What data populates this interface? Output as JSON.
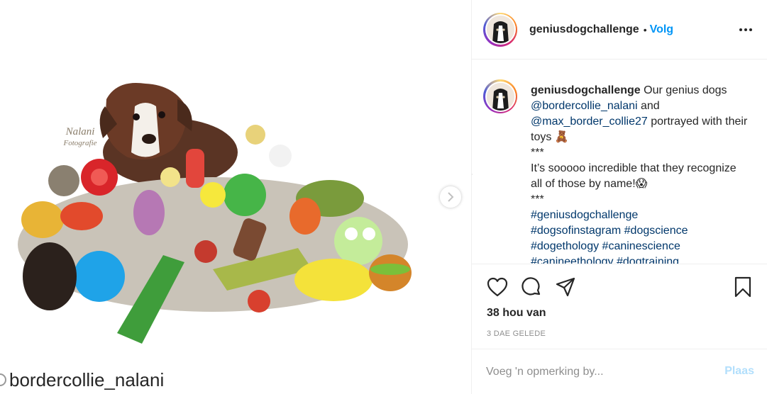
{
  "media": {
    "watermark_line1": "Nalani",
    "watermark_line2": "Fotografie",
    "tag_username": "bordercollie_nalani"
  },
  "header": {
    "username": "geniusdogchallenge",
    "separator": "•",
    "follow_label": "Volg",
    "more_icon": "more-horizontal-icon"
  },
  "caption": {
    "username": "geniusdogchallenge",
    "text_1": " Our genius dogs ",
    "mention_1": "@bordercollie_nalani",
    "text_2": " and ",
    "mention_2": "@max_border_collie27",
    "text_3": " portrayed with their toys 🧸",
    "stars_1": "***",
    "body": "It’s sooooo incredible that they recognize all of those by name!😱",
    "stars_2": "***",
    "hashtag_1": "#geniusdogchallenge",
    "hashtag_2": "#dogsofinstagram",
    "hashtag_3": "#dogscience",
    "hashtag_4": "#dogethology",
    "hashtag_5": "#caninescience",
    "hashtag_6": "#canineethology",
    "hashtag_7": "#dogtraining"
  },
  "actions": {
    "likes": "38 hou van",
    "date": "3 DAE GELEDE"
  },
  "comment": {
    "placeholder": "Voeg 'n opmerking by...",
    "post_label": "Plaas"
  },
  "colors": {
    "accent": "#0095f6",
    "post_disabled": "#b2dffc",
    "text": "#262626",
    "muted": "#8e8e8e",
    "divider": "#efefef"
  }
}
